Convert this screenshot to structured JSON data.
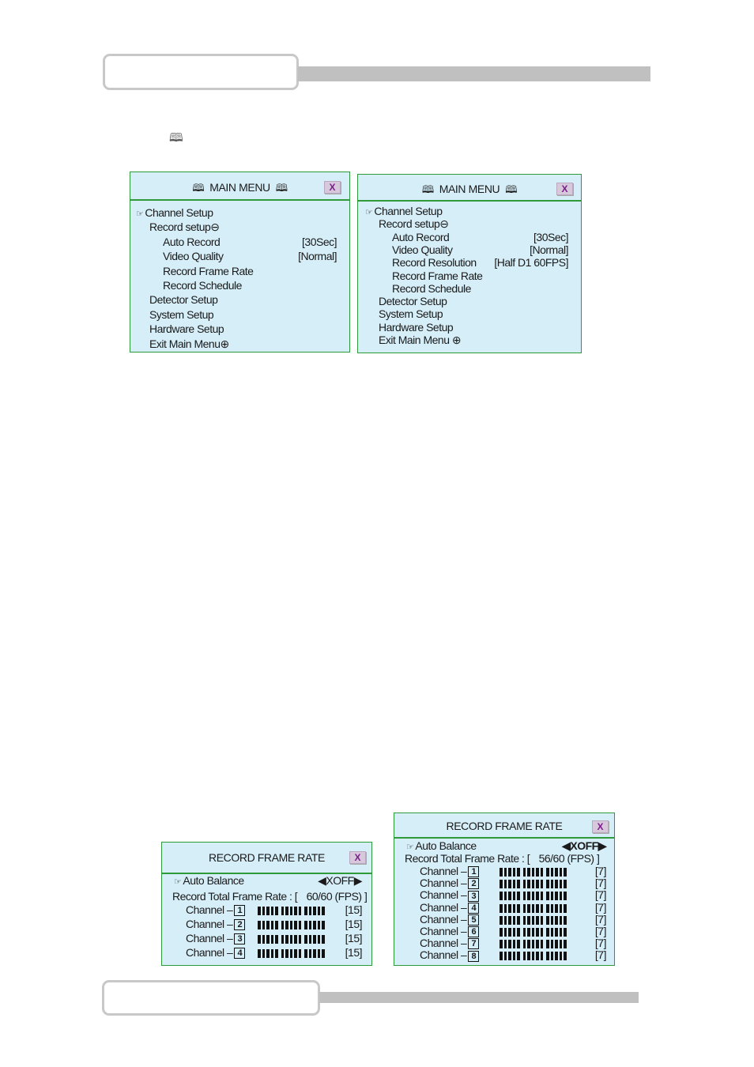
{
  "page": {
    "top_header_box": "",
    "bottom_header_box": "",
    "inline_icon": "book-icon"
  },
  "menu_a": {
    "title": "MAIN MENU",
    "close_label": "X",
    "items": [
      {
        "label": "Channel Setup",
        "level": 0,
        "selected": true,
        "value": ""
      },
      {
        "label": "Record setup⊖",
        "level": 0,
        "value": ""
      },
      {
        "label": "Auto Record",
        "level": 1,
        "value": "[30Sec]"
      },
      {
        "label": "Video Quality",
        "level": 1,
        "value": "[Normal]"
      },
      {
        "label": "Record Frame Rate",
        "level": 1,
        "value": ""
      },
      {
        "label": "Record Schedule",
        "level": 1,
        "value": ""
      },
      {
        "label": "Detector Setup",
        "level": 0,
        "value": ""
      },
      {
        "label": "System Setup",
        "level": 0,
        "value": ""
      },
      {
        "label": "Hardware Setup",
        "level": 0,
        "value": ""
      },
      {
        "label": "Exit Main Menu⊕",
        "level": 0,
        "value": ""
      }
    ]
  },
  "menu_b": {
    "title": "MAIN MENU",
    "close_label": "X",
    "items": [
      {
        "label": "Channel Setup",
        "level": 0,
        "selected": true,
        "value": ""
      },
      {
        "label": "Record setup⊖",
        "level": 0,
        "value": ""
      },
      {
        "label": "Auto Record",
        "level": 1,
        "value": "[30Sec]"
      },
      {
        "label": "Video Quality",
        "level": 1,
        "value": "[Normal]"
      },
      {
        "label": "Record Resolution",
        "level": 1,
        "value": "[Half D1 60FPS]"
      },
      {
        "label": "Record Frame Rate",
        "level": 1,
        "value": ""
      },
      {
        "label": "Record Schedule",
        "level": 1,
        "value": ""
      },
      {
        "label": "Detector Setup",
        "level": 0,
        "value": ""
      },
      {
        "label": "System Setup",
        "level": 0,
        "value": ""
      },
      {
        "label": "Hardware Setup",
        "level": 0,
        "value": ""
      },
      {
        "label": "Exit Main Menu ⊕",
        "level": 0,
        "value": ""
      }
    ]
  },
  "frame_rate_4ch": {
    "title": "RECORD  FRAME RATE",
    "close_label": "X",
    "auto_balance_label": "Auto Balance",
    "auto_balance_value": "◀XOFF▶",
    "total_label": "Record Total Frame Rate :  [",
    "total_value": "60/60 (FPS)  ]",
    "channels": [
      {
        "label": "Channel –",
        "num": "1",
        "value": "[15]",
        "fill": 1.0
      },
      {
        "label": "Channel –",
        "num": "2",
        "value": "[15]",
        "fill": 1.0
      },
      {
        "label": "Channel –",
        "num": "3",
        "value": "[15]",
        "fill": 1.0
      },
      {
        "label": "Channel –",
        "num": "4",
        "value": "[15]",
        "fill": 1.0
      }
    ]
  },
  "frame_rate_8ch": {
    "title": "RECORD  FRAME RATE",
    "close_label": "X",
    "auto_balance_label": "Auto Balance",
    "auto_balance_value": "◀XOFF▶",
    "total_label": "Record Total Frame Rate :  [",
    "total_value": "56/60 (FPS)  ]",
    "channels": [
      {
        "label": "Channel –",
        "num": "1",
        "value": "[7]",
        "fill": 1.0
      },
      {
        "label": "Channel –",
        "num": "2",
        "value": "[7]",
        "fill": 1.0
      },
      {
        "label": "Channel –",
        "num": "3",
        "value": "[7]",
        "fill": 1.0
      },
      {
        "label": "Channel –",
        "num": "4",
        "value": "[7]",
        "fill": 1.0
      },
      {
        "label": "Channel –",
        "num": "5",
        "value": "[7]",
        "fill": 1.0
      },
      {
        "label": "Channel –",
        "num": "6",
        "value": "[7]",
        "fill": 1.0
      },
      {
        "label": "Channel –",
        "num": "7",
        "value": "[7]",
        "fill": 1.0
      },
      {
        "label": "Channel –",
        "num": "8",
        "value": "[7]",
        "fill": 1.0
      }
    ]
  }
}
